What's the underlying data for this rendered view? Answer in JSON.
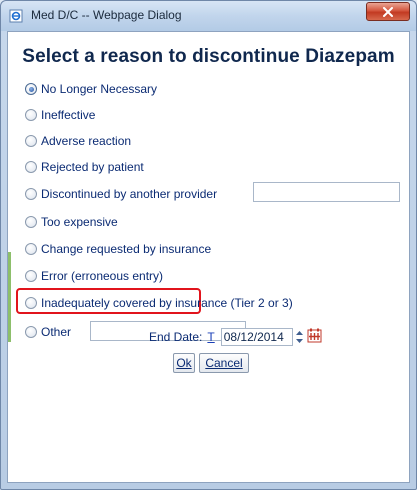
{
  "window": {
    "title": "Med D/C -- Webpage Dialog"
  },
  "dialog": {
    "heading": "Select a reason to discontinue Diazepam",
    "options": [
      {
        "label": "No Longer Necessary",
        "checked": true
      },
      {
        "label": "Ineffective",
        "checked": false
      },
      {
        "label": "Adverse reaction",
        "checked": false
      },
      {
        "label": "Rejected by patient",
        "checked": false
      },
      {
        "label": "Discontinued by another provider",
        "checked": false
      },
      {
        "label": "Too expensive",
        "checked": false
      },
      {
        "label": "Change requested by insurance",
        "checked": false
      },
      {
        "label": "Error (erroneous entry)",
        "checked": false,
        "highlighted": true
      },
      {
        "label": "Inadequately covered by insurance (Tier 2 or 3)",
        "checked": false
      },
      {
        "label": "Other",
        "checked": false
      }
    ],
    "provider_value": "",
    "other_value": "",
    "end_date_label": "End Date:",
    "today_link": "T",
    "end_date_value": "08/12/2014",
    "ok_label": "Ok",
    "cancel_label": "Cancel"
  },
  "colors": {
    "highlight": "#e1141c",
    "heading": "#10284e"
  }
}
